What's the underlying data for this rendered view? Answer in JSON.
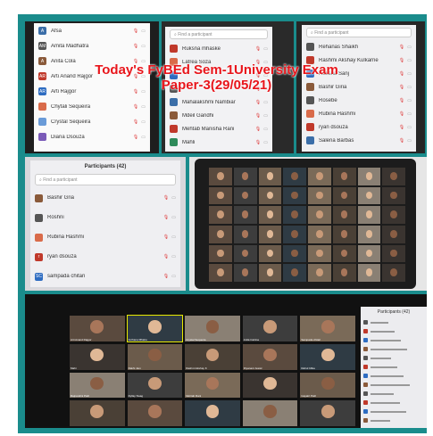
{
  "title": {
    "line1": "Today's FyBEd Sem-1University Exam",
    "line2": "Paper-3(29/05/21)"
  },
  "colors": {
    "accent": "#1a8c8c",
    "title": "#e8151b",
    "mic_off": "#dd3333"
  },
  "panel1": {
    "participants": [
      {
        "initials": "A",
        "name": "Afsa",
        "color": "#3b6ea8"
      },
      {
        "initials": "AM",
        "name": "Amita Madhatra",
        "color": "#555555"
      },
      {
        "initials": "A",
        "name": "Anita Cola",
        "color": "#8a5a3a"
      },
      {
        "initials": "AR",
        "name": "Arti Anand Rajgor",
        "color": "#c0392b"
      },
      {
        "initials": "AR",
        "name": "Arti Rajgor",
        "color": "#2e6cc1"
      },
      {
        "initials": "",
        "name": "Chytali Sequeira",
        "color": "#d96b4a"
      },
      {
        "initials": "",
        "name": "Crystal Sequeira",
        "color": "#6a9bd8"
      },
      {
        "initials": "",
        "name": "Diana Dsouza",
        "color": "#7a5ab8"
      }
    ]
  },
  "panel2": {
    "search_placeholder": "Find a participant",
    "participants": [
      {
        "initials": "",
        "name": "Ruksna mhaske",
        "color": "#c0392b"
      },
      {
        "initials": "",
        "name": "Latrea Soza",
        "color": "#d96b4a"
      },
      {
        "initials": "",
        "name": "",
        "color": "#2e6cc1"
      },
      {
        "initials": "",
        "name": "",
        "color": "#555555"
      },
      {
        "initials": "",
        "name": "Mahalakshmi Nambiar",
        "color": "#3b6ea8"
      },
      {
        "initials": "",
        "name": "Mdeil Gandhi",
        "color": "#8a5a3a"
      },
      {
        "initials": "",
        "name": "Mehtab Manisha Rani",
        "color": "#c0392b"
      },
      {
        "initials": "",
        "name": "Mahli",
        "color": "#2e8a5a"
      }
    ]
  },
  "panel3": {
    "search_placeholder": "Find a participant",
    "participants": [
      {
        "initials": "",
        "name": "Rehanas Shaikh",
        "color": "#555555"
      },
      {
        "initials": "",
        "name": "Rashmi Akshay Kulkarne",
        "color": "#c0392b"
      },
      {
        "initials": "",
        "name": "Raksha Sanj",
        "color": "#2e6cc1"
      },
      {
        "initials": "",
        "name": "Bashir Giria",
        "color": "#8a5a3a"
      },
      {
        "initials": "",
        "name": "Rosebe",
        "color": "#555555"
      },
      {
        "initials": "",
        "name": "Rubina Hashmi",
        "color": "#d96b4a"
      },
      {
        "initials": "",
        "name": "ryan dsouza",
        "color": "#c0392b"
      },
      {
        "initials": "",
        "name": "Salena Barbas",
        "color": "#3b6ea8"
      }
    ]
  },
  "panel4": {
    "header": "Participants (42)",
    "search_placeholder": "Find a participant",
    "participants": [
      {
        "initials": "",
        "name": "Bashir Gria",
        "color": "#8a5a3a"
      },
      {
        "initials": "",
        "name": "Roshni",
        "color": "#555555"
      },
      {
        "initials": "",
        "name": "Rubina Hashmi",
        "color": "#d96b4a"
      },
      {
        "initials": "r",
        "name": "ryan dsouza",
        "color": "#c0392b"
      },
      {
        "initials": "SC",
        "name": "sampada chitari",
        "color": "#2e6cc1"
      }
    ]
  },
  "gallery_labels": [
    "Arti Anand Rajgor",
    "Archana Mhatre",
    "Crystal Sequeira",
    "Anila Catrina",
    "Sampada chitari",
    "Mahi",
    "Rakhi Jam",
    "Rashmi Akshay K",
    "Diyanant Jessic",
    "Rahul Ulika",
    "Rajnandini Patil",
    "Dyllay Swag",
    "Mehtab Rani",
    "",
    "Gayatri Patil"
  ],
  "panel6": {
    "header": "Participants (42)"
  }
}
